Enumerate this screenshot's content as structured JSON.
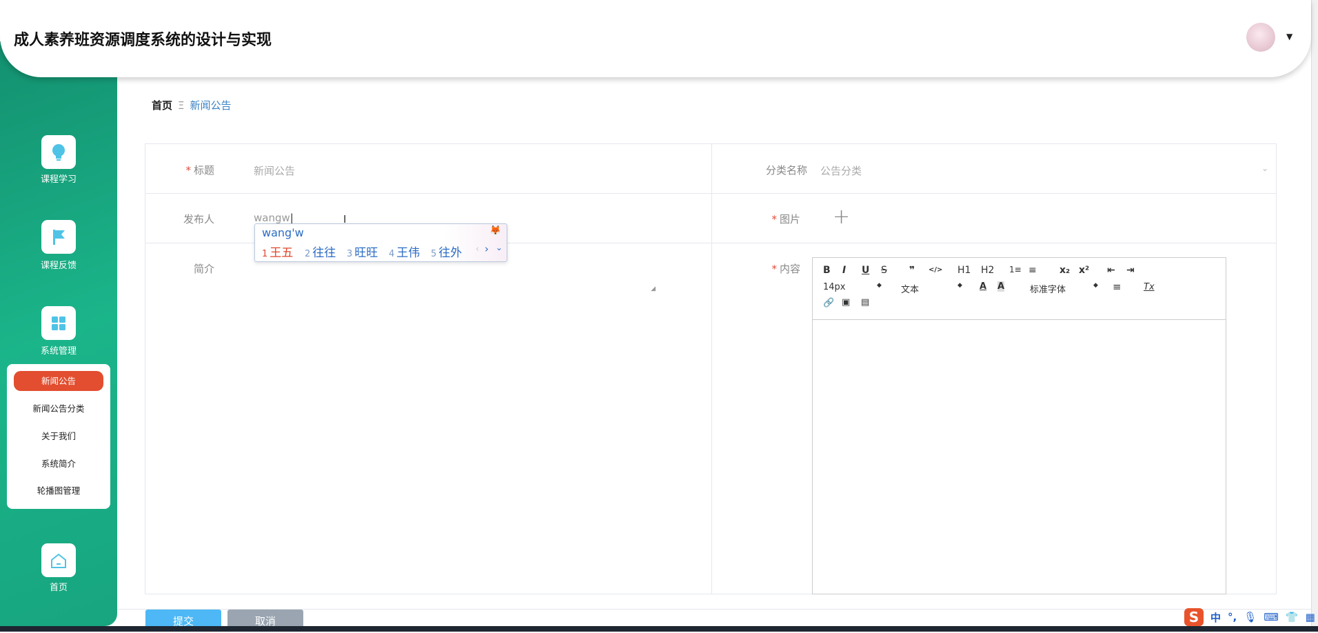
{
  "header": {
    "title": "成人素养班资源调度系统的设计与实现",
    "avatar_icon": "user-avatar",
    "dropdown_icon": "caret-down"
  },
  "sidebar": {
    "items": [
      {
        "label": "课程学习",
        "icon": "lightbulb-icon"
      },
      {
        "label": "课程反馈",
        "icon": "flag-icon"
      },
      {
        "label": "系统管理",
        "icon": "grid-icon"
      },
      {
        "label": "首页",
        "icon": "home-icon"
      }
    ],
    "submenu": [
      {
        "label": "新闻公告",
        "active": true
      },
      {
        "label": "新闻公告分类"
      },
      {
        "label": "关于我们"
      },
      {
        "label": "系统简介"
      },
      {
        "label": "轮播图管理"
      }
    ],
    "active_color": "#e24e2f"
  },
  "breadcrumb": {
    "home": "首页",
    "separator": "Ξ",
    "current": "新闻公告"
  },
  "form": {
    "title_label": "标题",
    "title_value": "新闻公告",
    "category_label": "分类名称",
    "category_value": "公告分类",
    "publisher_label": "发布人",
    "publisher_value": "wangw",
    "image_label": "图片",
    "image_add": "+",
    "summary_label": "简介",
    "content_label": "内容",
    "required_mark": "*"
  },
  "editor": {
    "row1": [
      "B",
      "I",
      "U",
      "S",
      "❞",
      "</>",
      "H1",
      "H2",
      "1≡",
      "≡",
      "x₂",
      "x²",
      "⇤",
      "⇥"
    ],
    "font_size": "14px",
    "text_style": "文本",
    "font_family": "标准字体",
    "clear_format": "Tx"
  },
  "ime": {
    "composition": "wang'w",
    "candidates": [
      {
        "n": "1",
        "text": "王五"
      },
      {
        "n": "2",
        "text": "往往"
      },
      {
        "n": "3",
        "text": "旺旺"
      },
      {
        "n": "4",
        "text": "王伟"
      },
      {
        "n": "5",
        "text": "往外"
      }
    ]
  },
  "buttons": {
    "submit": "提交",
    "cancel": "取消",
    "submit_color": "#4db8f5",
    "cancel_color": "#9aa5b1"
  },
  "tray": {
    "ime_mode": "中",
    "punct": "°,"
  }
}
